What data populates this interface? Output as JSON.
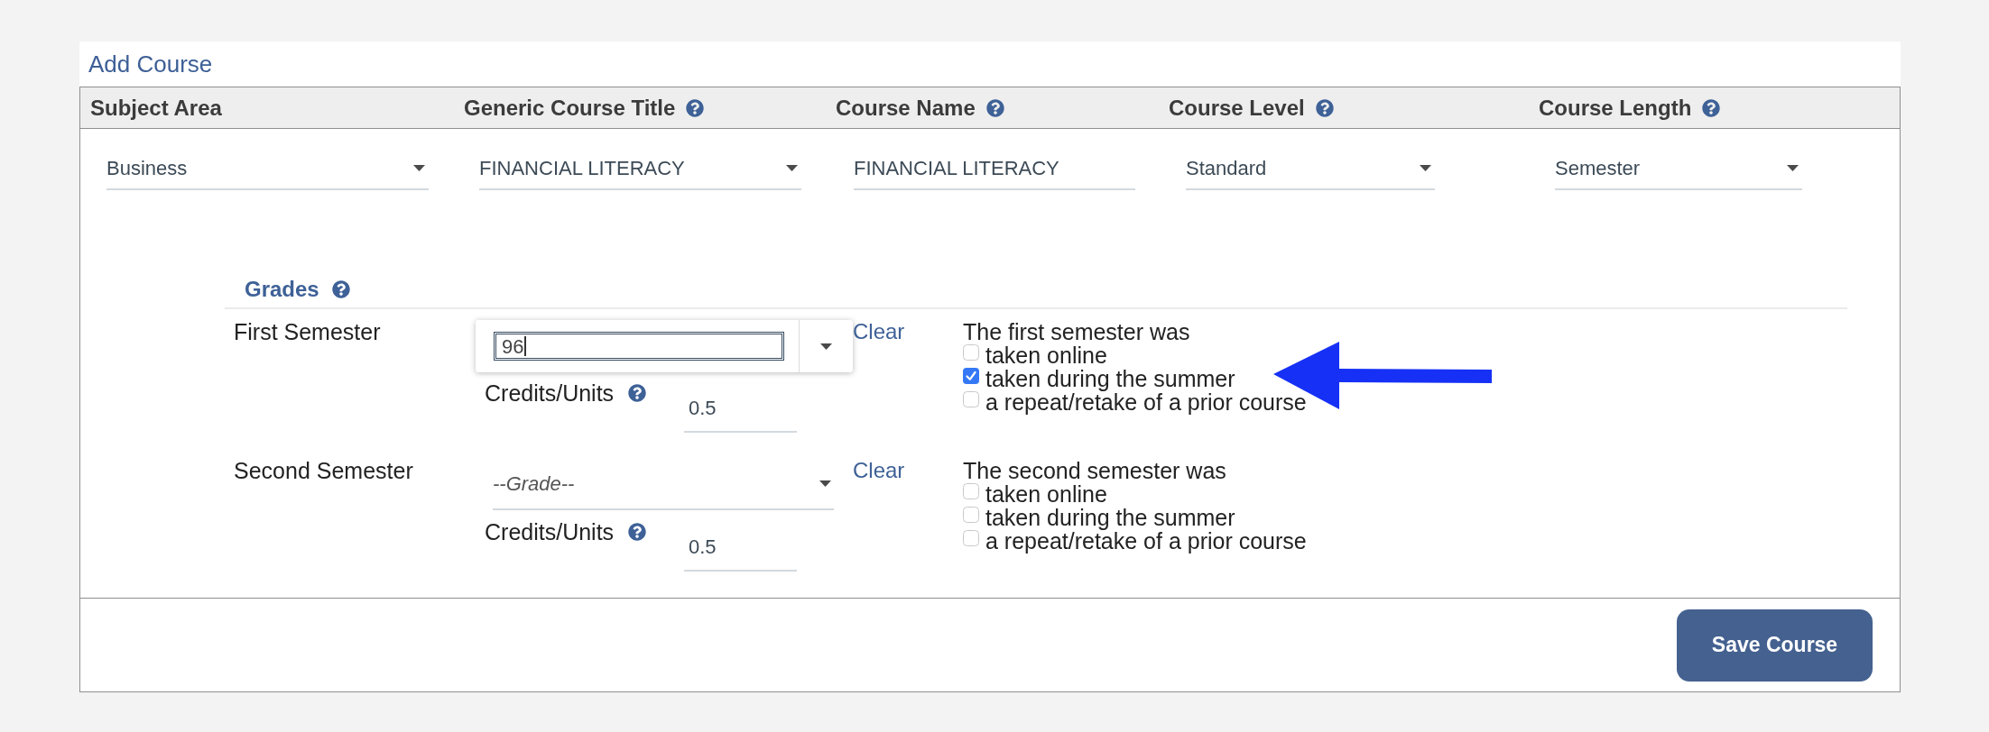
{
  "title": "Add Course",
  "columns": [
    {
      "label": "Subject Area",
      "help": false
    },
    {
      "label": "Generic Course Title",
      "help": true
    },
    {
      "label": "Course Name",
      "help": true
    },
    {
      "label": "Course Level",
      "help": true
    },
    {
      "label": "Course Length",
      "help": true
    }
  ],
  "fields": [
    {
      "kind": "select",
      "value": "Business"
    },
    {
      "kind": "select",
      "value": "FINANCIAL LITERACY"
    },
    {
      "kind": "text",
      "value": "FINANCIAL LITERACY"
    },
    {
      "kind": "select",
      "value": "Standard"
    },
    {
      "kind": "select",
      "value": "Semester"
    }
  ],
  "grades": {
    "title": "Grades",
    "help": true,
    "semesters": [
      {
        "label": "First Semester",
        "grade": {
          "open": true,
          "value": "96"
        },
        "clear": "Clear",
        "credits": {
          "label": "Credits/Units",
          "help": true,
          "value": "0.5"
        },
        "options_title": "The first semester was",
        "options": [
          {
            "label": "taken online",
            "checked": false
          },
          {
            "label": "taken during the summer",
            "checked": true
          },
          {
            "label": "a repeat/retake of a prior course",
            "checked": false
          }
        ]
      },
      {
        "label": "Second Semester",
        "grade": {
          "open": false,
          "placeholder": "--Grade--"
        },
        "clear": "Clear",
        "credits": {
          "label": "Credits/Units",
          "help": true,
          "value": "0.5"
        },
        "options_title": "The second semester was",
        "options": [
          {
            "label": "taken online",
            "checked": false
          },
          {
            "label": "taken during the summer",
            "checked": false
          },
          {
            "label": "a repeat/retake of a prior course",
            "checked": false
          }
        ]
      }
    ]
  },
  "save_button": "Save Course"
}
